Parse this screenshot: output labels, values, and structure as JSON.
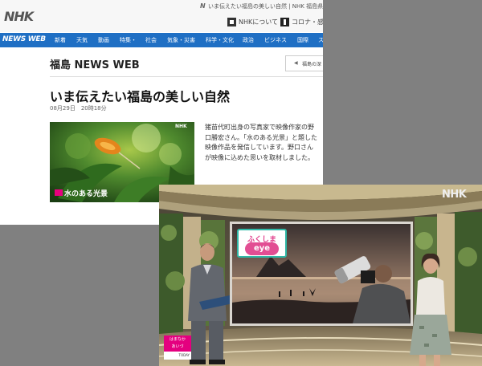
{
  "web": {
    "logo": "NHK",
    "crumb_mark": "N",
    "crumb_text": "いま伝えたい福島の美しい自然 | NHK 福島県のニュース",
    "about_label": "NHKについて",
    "corona_label": "コロナ・感染",
    "nav_brand": "NEWS WEB",
    "nav_items": [
      "新着",
      "天気",
      "動画",
      "特集・",
      "社会",
      "気象・災害",
      "科学・文化",
      "政治",
      "ビジネス",
      "国際",
      "ス"
    ],
    "section_title": "福島 NEWS WEB",
    "back_arrow": "◀",
    "back_label": "福島の深",
    "article_title": "いま伝えたい福島の美しい自然",
    "article_date": "08月29日　20時18分",
    "thumbnail_logo": "NHK",
    "thumbnail_caption": "水のある光景",
    "article_body": "猪苗代町出身の写真家で映像作家の野口勝宏さん。「水のある光景」と題した映像作品を発信しています。野口さんが映像に込めた思いを取材しました。"
  },
  "tv": {
    "channel_logo": "NHK",
    "program_logo_top": "ふくしま",
    "program_logo_bottom": "eye",
    "corner_tag": "はまなか\nあいづ",
    "corner_tag_sub": "TODAY"
  },
  "colors": {
    "nav_blue": "#1f6fc4",
    "program_pink": "#e24e93",
    "program_teal": "#2fb9a7"
  }
}
